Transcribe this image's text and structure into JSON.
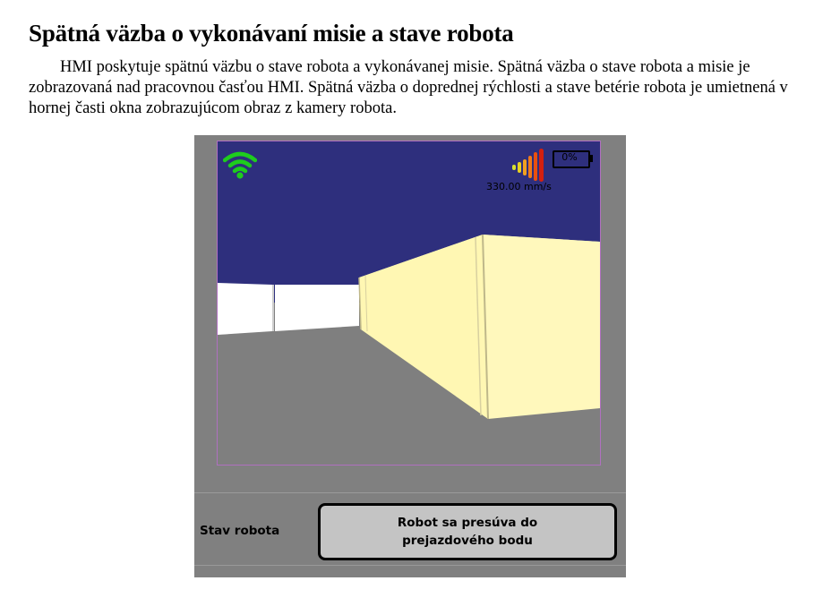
{
  "document": {
    "heading": "Spätná väzba o vykonávaní misie a stave robota",
    "paragraph": "HMI poskytuje spätnú väzbu o stave robota a vykonávanej misie. Spätná väzba o stave robota a misie je zobrazovaná nad pracovnou časťou HMI. Spätná väzba o doprednej rýchlosti a stave betérie robota je umietnená v hornej časti okna zobrazujúcom obraz z kamery robota."
  },
  "hmi": {
    "battery_level_text": "0%",
    "battery_level_fraction": 0.0,
    "speed_text": "330.00 mm/s",
    "robot_status_label": "Stav robota",
    "robot_status_value": "Robot sa presúva do prejazdového bodu",
    "icons": {
      "connection": "wifi-signal-icon",
      "speed": "speed-bars-icon",
      "battery": "battery-icon"
    },
    "colors": {
      "sky": "#2e2f7d",
      "floor": "#7f7f7f",
      "box": "#fff7b3",
      "wall": "#ffffff",
      "wifi": "#1ecc1e",
      "panel": "#808080",
      "status_box": "#c4c4c4"
    }
  }
}
